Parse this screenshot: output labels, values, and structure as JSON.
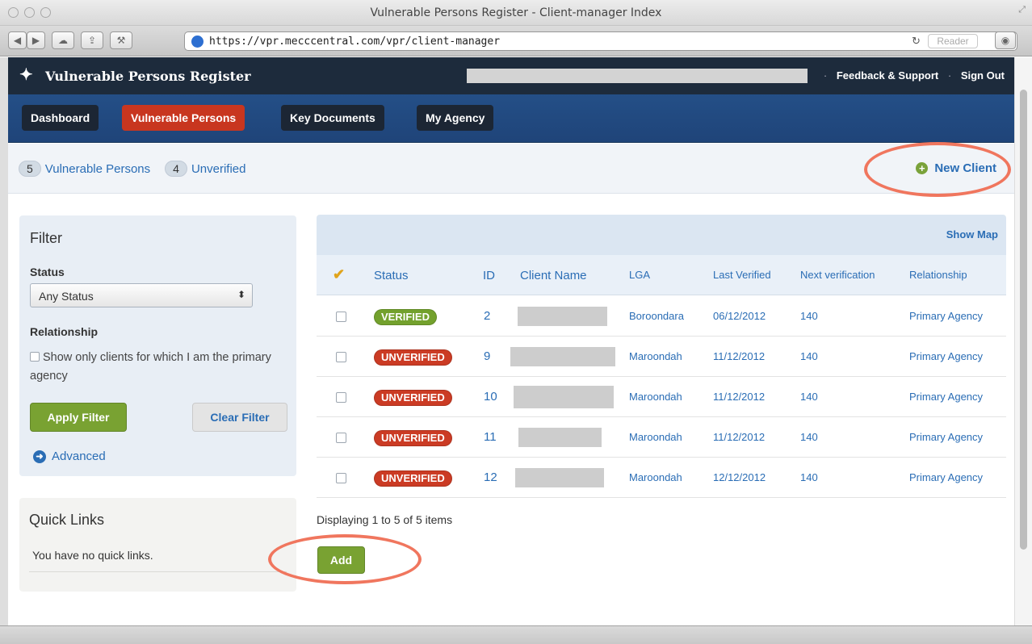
{
  "browser": {
    "window_title": "Vulnerable Persons Register - Client-manager Index",
    "url": "https://vpr.mecccentral.com/vpr/client-manager",
    "reader_label": "Reader"
  },
  "header": {
    "app_title": "Vulnerable Persons Register",
    "feedback_label": "Feedback & Support",
    "signout_label": "Sign Out",
    "separator": "·"
  },
  "nav": {
    "tabs": [
      {
        "label": "Dashboard",
        "active": false
      },
      {
        "label": "Vulnerable Persons",
        "active": true
      },
      {
        "label": "Key Documents",
        "active": false
      },
      {
        "label": "My Agency",
        "active": false
      }
    ]
  },
  "summary": {
    "persons_count": "5",
    "persons_label": "Vulnerable Persons",
    "unverified_count": "4",
    "unverified_label": "Unverified",
    "new_client_label": "New Client"
  },
  "filter": {
    "title": "Filter",
    "status_label": "Status",
    "status_value": "Any Status",
    "relationship_label": "Relationship",
    "checkbox_label": "Show only clients for which I am the primary agency",
    "apply_label": "Apply Filter",
    "clear_label": "Clear Filter",
    "advanced_label": "Advanced"
  },
  "quick_links": {
    "title": "Quick Links",
    "empty_text": "You have no quick links."
  },
  "table": {
    "show_map_label": "Show Map",
    "headers": [
      "Status",
      "ID",
      "Client Name",
      "LGA",
      "Last Verified",
      "Next verification",
      "Relationship"
    ],
    "rows": [
      {
        "status": "VERIFIED",
        "verified": true,
        "id": "2",
        "lga": "Boroondara",
        "last_verified": "06/12/2012",
        "next": "140",
        "relationship": "Primary Agency"
      },
      {
        "status": "UNVERIFIED",
        "verified": false,
        "id": "9",
        "lga": "Maroondah",
        "last_verified": "11/12/2012",
        "next": "140",
        "relationship": "Primary Agency"
      },
      {
        "status": "UNVERIFIED",
        "verified": false,
        "id": "10",
        "lga": "Maroondah",
        "last_verified": "11/12/2012",
        "next": "140",
        "relationship": "Primary Agency"
      },
      {
        "status": "UNVERIFIED",
        "verified": false,
        "id": "11",
        "lga": "Maroondah",
        "last_verified": "11/12/2012",
        "next": "140",
        "relationship": "Primary Agency"
      },
      {
        "status": "UNVERIFIED",
        "verified": false,
        "id": "12",
        "lga": "Maroondah",
        "last_verified": "12/12/2012",
        "next": "140",
        "relationship": "Primary Agency"
      }
    ],
    "displaying_text": "Displaying 1 to 5 of 5 items",
    "add_label": "Add"
  },
  "colors": {
    "nav_active": "#c8361f",
    "verified": "#73a12d",
    "unverified": "#cb3b24",
    "link": "#2a6db5",
    "annotation": "#f0765e"
  }
}
